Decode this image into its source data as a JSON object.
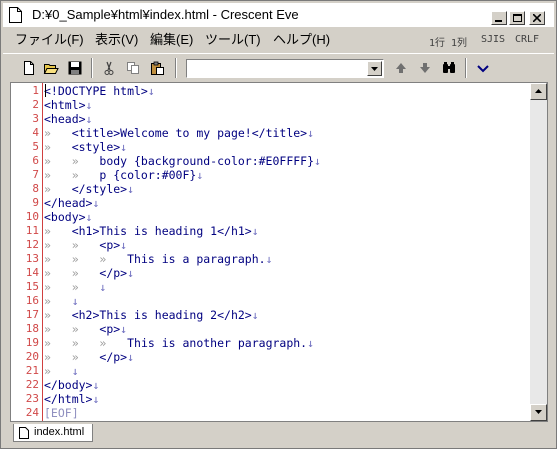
{
  "window": {
    "title": "D:¥0_Sample¥html¥index.html - Crescent Eve"
  },
  "menu": [
    {
      "label": "ファイル(F)"
    },
    {
      "label": "表示(V)"
    },
    {
      "label": "編集(E)"
    },
    {
      "label": "ツール(T)"
    },
    {
      "label": "ヘルプ(H)"
    }
  ],
  "status": {
    "position": "1行 1列",
    "encoding": "SJIS",
    "line_ending": "CRLF"
  },
  "toolbar": {
    "buttons": [
      "new-file-icon",
      "open-folder-icon",
      "save-icon",
      "cut-icon",
      "copy-icon",
      "paste-icon",
      "search-up-icon",
      "search-down-icon",
      "find-binoculars-icon",
      "dropdown-chevron-icon"
    ],
    "search_value": ""
  },
  "editor": {
    "lines": [
      {
        "n": "1",
        "tabs": "",
        "text": "<!DOCTYPE html>"
      },
      {
        "n": "2",
        "tabs": "",
        "text": "<html>"
      },
      {
        "n": "3",
        "tabs": "",
        "text": "<head>"
      },
      {
        "n": "4",
        "tabs": "»   ",
        "text": "<title>Welcome to my page!</title>"
      },
      {
        "n": "5",
        "tabs": "»   ",
        "text": "<style>"
      },
      {
        "n": "6",
        "tabs": "»   »   ",
        "text": "body {background-color:#E0FFFF}"
      },
      {
        "n": "7",
        "tabs": "»   »   ",
        "text": "p {color:#00F}"
      },
      {
        "n": "8",
        "tabs": "»   ",
        "text": "</style>"
      },
      {
        "n": "9",
        "tabs": "",
        "text": "</head>"
      },
      {
        "n": "10",
        "tabs": "",
        "text": "<body>"
      },
      {
        "n": "11",
        "tabs": "»   ",
        "text": "<h1>This is heading 1</h1>"
      },
      {
        "n": "12",
        "tabs": "»   »   ",
        "text": "<p>"
      },
      {
        "n": "13",
        "tabs": "»   »   »   ",
        "text": "This is a paragraph."
      },
      {
        "n": "14",
        "tabs": "»   »   ",
        "text": "</p>"
      },
      {
        "n": "15",
        "tabs": "»   »   ",
        "text": ""
      },
      {
        "n": "16",
        "tabs": "»   ",
        "text": ""
      },
      {
        "n": "17",
        "tabs": "»   ",
        "text": "<h2>This is heading 2</h2>"
      },
      {
        "n": "18",
        "tabs": "»   »   ",
        "text": "<p>"
      },
      {
        "n": "19",
        "tabs": "»   »   »   ",
        "text": "This is another paragraph."
      },
      {
        "n": "20",
        "tabs": "»   »   ",
        "text": "</p>"
      },
      {
        "n": "21",
        "tabs": "»   ",
        "text": ""
      },
      {
        "n": "22",
        "tabs": "",
        "text": "</body>"
      },
      {
        "n": "23",
        "tabs": "",
        "text": "</html>"
      },
      {
        "n": "24",
        "tabs": "",
        "text": ""
      }
    ],
    "eol_mark": "↓",
    "eof_mark": "[EOF]"
  },
  "tabs": [
    {
      "label": "index.html"
    }
  ]
}
